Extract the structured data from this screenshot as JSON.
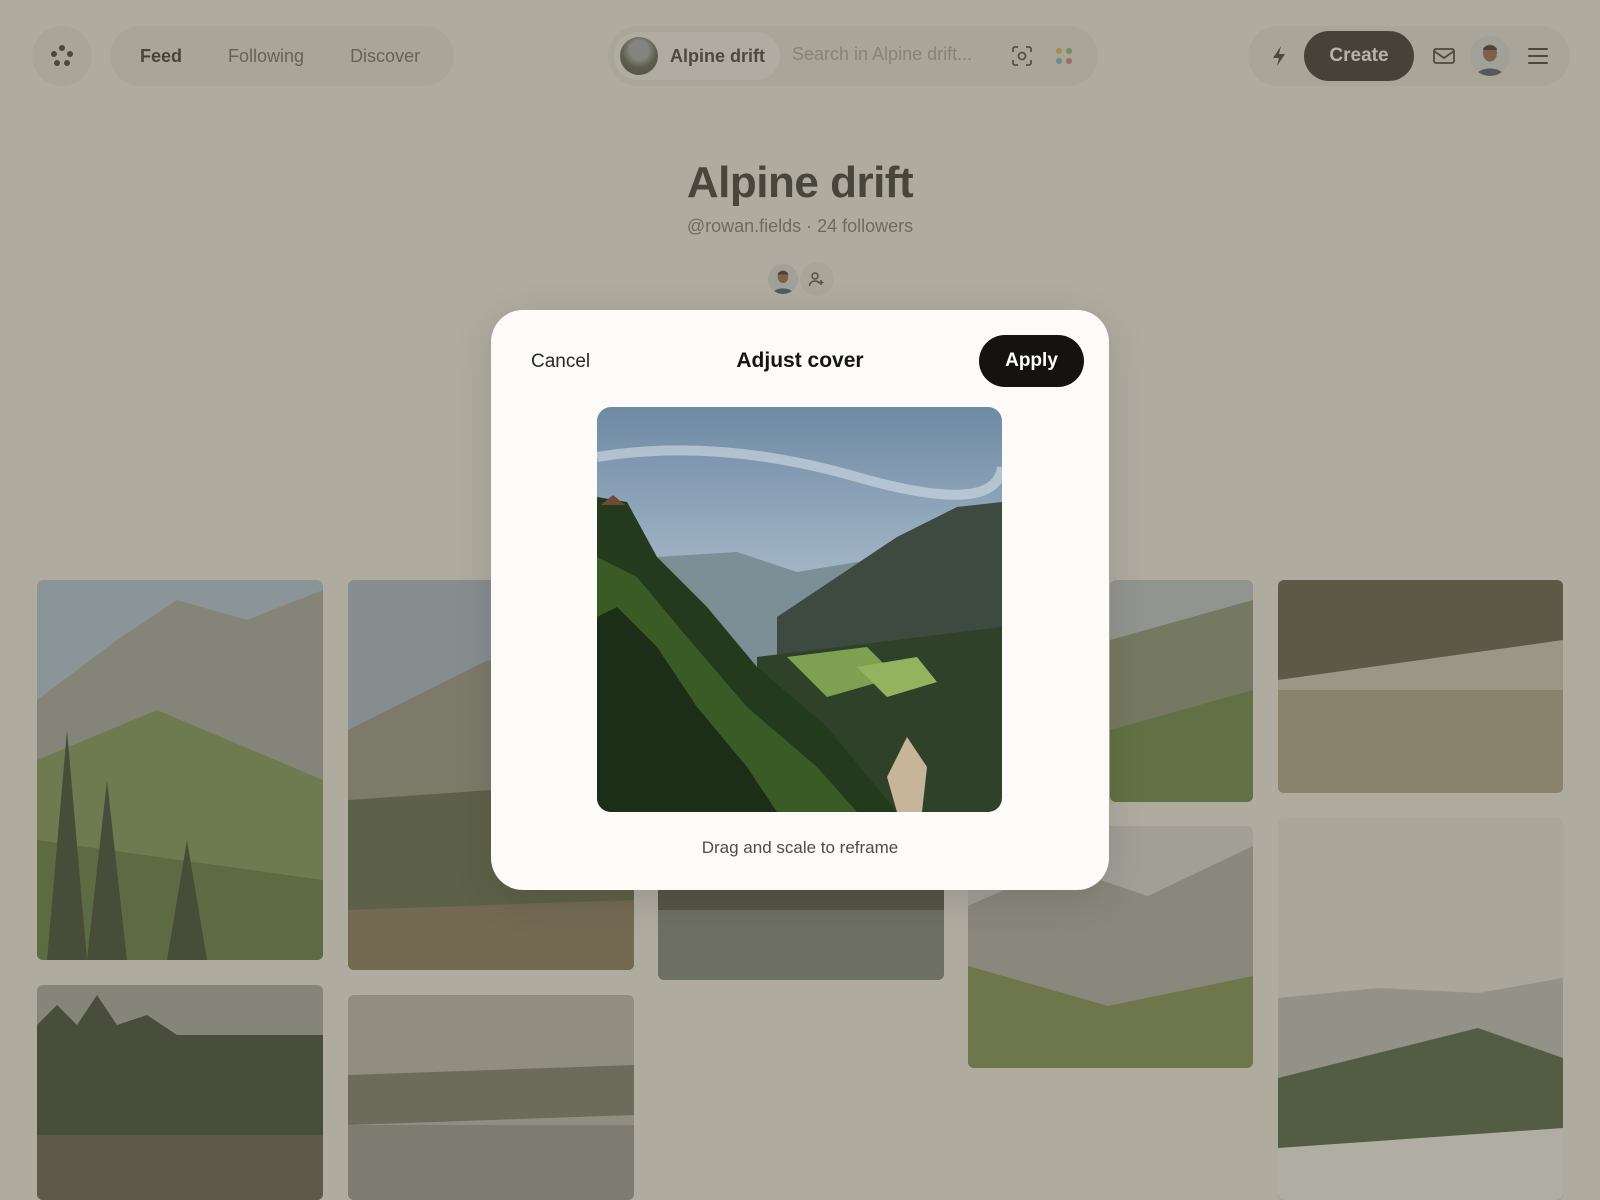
{
  "header": {
    "nav": [
      "Feed",
      "Following",
      "Discover"
    ],
    "board_chip_label": "Alpine drift",
    "search_placeholder": "Search in Alpine drift...",
    "create_label": "Create"
  },
  "board": {
    "title": "Alpine drift",
    "meta": "@rowan.fields · 24 followers"
  },
  "modal": {
    "cancel_label": "Cancel",
    "title": "Adjust cover",
    "apply_label": "Apply",
    "hint": "Drag and scale to reframe"
  },
  "colors": {
    "accent": "#141312",
    "page_bg": "#f1efe9",
    "scrim": "rgba(110,104,86,0.5)"
  },
  "icons": [
    "logo-icon",
    "visual-search-icon",
    "color-dots-icon",
    "bolt-icon",
    "mail-icon",
    "menu-icon",
    "add-person-icon"
  ]
}
